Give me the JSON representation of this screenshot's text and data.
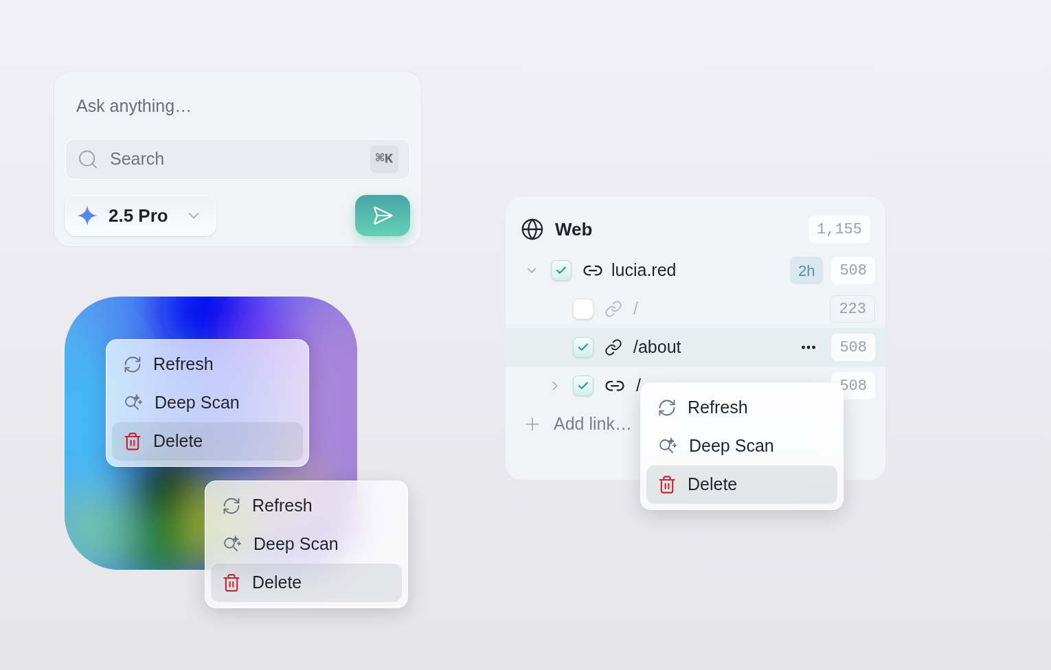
{
  "composer": {
    "placeholder": "Ask anything…",
    "search": {
      "placeholder": "Search",
      "shortcut": "⌘K"
    },
    "model": "2.5 Pro"
  },
  "menus": [
    {
      "items": [
        {
          "kind": "refresh",
          "label": "Refresh",
          "selected": false
        },
        {
          "kind": "scan",
          "label": "Deep Scan",
          "selected": false
        },
        {
          "kind": "delete",
          "label": "Delete",
          "selected": true
        }
      ]
    },
    {
      "items": [
        {
          "kind": "refresh",
          "label": "Refresh",
          "selected": false
        },
        {
          "kind": "scan",
          "label": "Deep Scan",
          "selected": false
        },
        {
          "kind": "delete",
          "label": "Delete",
          "selected": true
        }
      ]
    },
    {
      "items": [
        {
          "kind": "refresh",
          "label": "Refresh",
          "selected": false
        },
        {
          "kind": "scan",
          "label": "Deep Scan",
          "selected": false
        },
        {
          "kind": "delete",
          "label": "Delete",
          "selected": true
        }
      ]
    }
  ],
  "web_panel": {
    "title": "Web",
    "count": "1,155",
    "site": {
      "label": "lucia.red",
      "checked": true,
      "expanded": true,
      "age": "2h",
      "count": "508",
      "children": [
        {
          "kind": "page",
          "label": "/",
          "checked": false,
          "disabled": true,
          "selected": false,
          "count": "223"
        },
        {
          "kind": "page",
          "label": "/about",
          "checked": true,
          "disabled": false,
          "selected": true,
          "count": "508"
        },
        {
          "kind": "group",
          "label": "/",
          "checked": true,
          "disabled": false,
          "selected": false,
          "expanded": false,
          "count": "508"
        }
      ]
    },
    "add_link": "Add link…"
  }
}
